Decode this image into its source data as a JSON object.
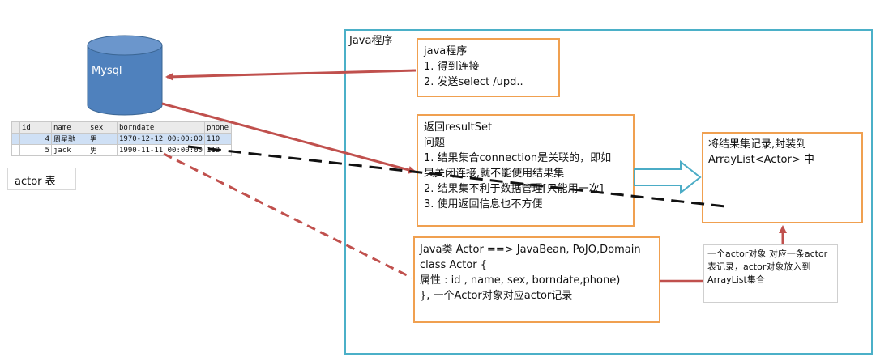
{
  "java_frame": {
    "label": "Java程序"
  },
  "database": {
    "label": "Mysql"
  },
  "db_table": {
    "headers": [
      "id",
      "name",
      "sex",
      "borndate",
      "phone"
    ],
    "rows": [
      [
        "4",
        "周星驰",
        "男",
        "1970-12-12 00:00:00",
        "110"
      ],
      [
        "5",
        "jack",
        "男",
        "1990-11-11 00:00:00",
        "112"
      ]
    ],
    "caption": "actor 表"
  },
  "box_program": {
    "lines": [
      "java程序",
      "1. 得到连接",
      "2. 发送select /upd.."
    ]
  },
  "box_resultset": {
    "lines": [
      "返回resultSet",
      "问题",
      "1. 结果集合connection是关联的，即如",
      "果关闭连接,就不能使用结果集",
      "2. 结果集不利于数据管理[只能用一次]",
      "3. 使用返回信息也不方便"
    ]
  },
  "box_arraylist": {
    "lines": [
      "将结果集记录,封装到",
      "ArrayList<Actor> 中"
    ]
  },
  "box_actor_class": {
    "lines": [
      "Java类 Actor  ==> JavaBean, PoJO,Domain",
      "class Actor {",
      "属性 : id , name, sex, borndate,phone)",
      "}, 一个Actor对象对应actor记录"
    ]
  },
  "note": {
    "lines": [
      "一个actor对象 对应一条actor",
      "表记录，actor对象放入到",
      "ArrayList集合"
    ]
  },
  "colors": {
    "orange_border": "#f0a050",
    "frame_border": "#4bb0c8",
    "arrow_red": "#c0504d",
    "cylinder_fill": "#4f81bd",
    "hollow_arrow": "#4bacc6"
  }
}
